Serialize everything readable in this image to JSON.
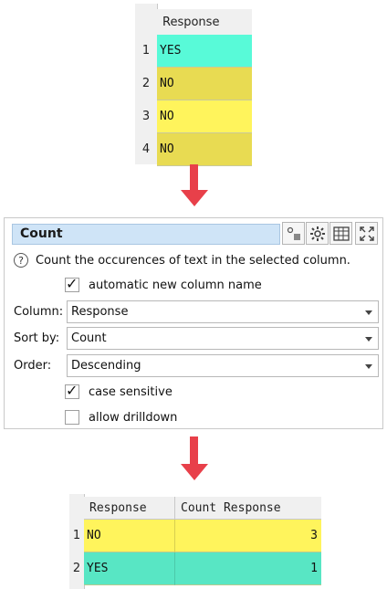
{
  "input_table": {
    "header": "Response",
    "rows": [
      {
        "num": "1",
        "value": "YES",
        "color": "#58fad8"
      },
      {
        "num": "2",
        "value": "NO",
        "color": "#e8db52"
      },
      {
        "num": "3",
        "value": "NO",
        "color": "#fff45c"
      },
      {
        "num": "4",
        "value": "NO",
        "color": "#e8db52"
      }
    ]
  },
  "dialog": {
    "title": "Count",
    "help_text": "Count the occurences of text in the selected column.",
    "auto_name_label": "automatic new column name",
    "auto_name_checked": true,
    "column_label": "Column:",
    "column_value": "Response",
    "sortby_label": "Sort by:",
    "sortby_value": "Count",
    "order_label": "Order:",
    "order_value": "Descending",
    "case_label": "case sensitive",
    "case_checked": true,
    "drilldown_label": "allow drilldown",
    "drilldown_checked": false,
    "help_icon": "?"
  },
  "output_table": {
    "headers": [
      "Response",
      "Count Response"
    ],
    "rows": [
      {
        "num": "1",
        "response": "NO",
        "count": "3",
        "color": "#fff45c"
      },
      {
        "num": "2",
        "response": "YES",
        "count": "1",
        "color": "#58e6c4"
      }
    ]
  },
  "colors": {
    "arrow": "#e8404a",
    "title_bar": "#cfe4f7"
  }
}
